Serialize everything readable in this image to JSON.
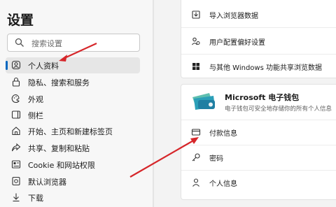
{
  "sidebar": {
    "title": "设置",
    "search_placeholder": "搜索设置",
    "items": [
      {
        "label": "个人资料",
        "icon": "profile-icon",
        "active": true
      },
      {
        "label": "隐私、搜索和服务",
        "icon": "lock-icon"
      },
      {
        "label": "外观",
        "icon": "appearance-icon"
      },
      {
        "label": "侧栏",
        "icon": "sidebar-icon"
      },
      {
        "label": "开始、主页和新建标签页",
        "icon": "home-icon"
      },
      {
        "label": "共享、复制和粘贴",
        "icon": "share-icon"
      },
      {
        "label": "Cookie 和网站权限",
        "icon": "cookie-icon"
      },
      {
        "label": "默认浏览器",
        "icon": "browser-icon"
      },
      {
        "label": "下载",
        "icon": "download-icon"
      }
    ]
  },
  "main": {
    "top_card": [
      {
        "label": "导入浏览器数据",
        "icon": "import-icon"
      },
      {
        "label": "用户配置偏好设置",
        "icon": "people-icon"
      },
      {
        "label": "与其他 Windows 功能共享浏览数据",
        "icon": "windows-icon"
      }
    ],
    "wallet": {
      "title": "Microsoft 电子钱包",
      "subtitle": "电子钱包可安全地存储你的所有个人信息",
      "icon": "wallet-icon"
    },
    "wallet_rows": [
      {
        "label": "付款信息",
        "icon": "card-icon"
      },
      {
        "label": "密码",
        "icon": "key-icon"
      },
      {
        "label": "个人信息",
        "icon": "person-icon"
      }
    ]
  },
  "colors": {
    "accent": "#0067c0",
    "annotation_arrow": "#d6262a"
  }
}
